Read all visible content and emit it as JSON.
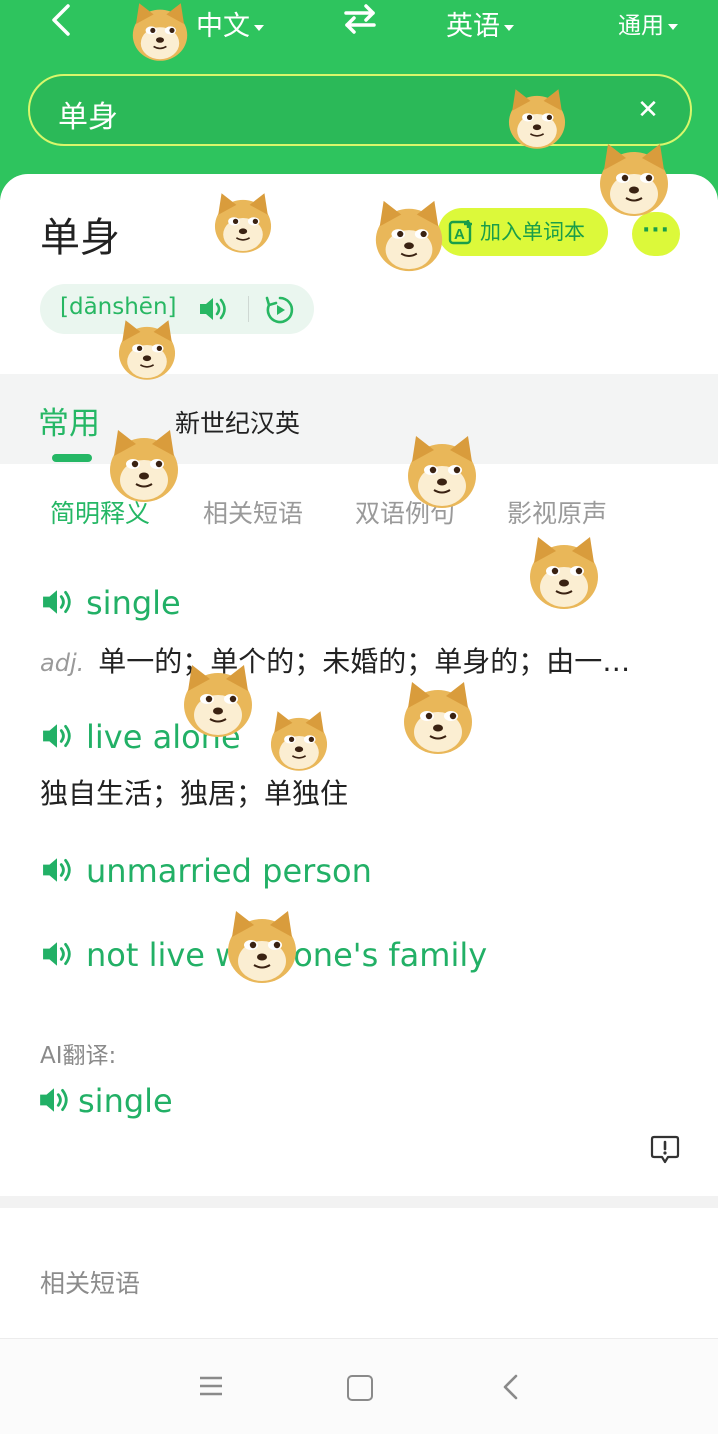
{
  "topbar": {
    "source_lang": "中文",
    "target_lang": "英语",
    "mode": "通用"
  },
  "search": {
    "query": "单身"
  },
  "word": {
    "title": "单身",
    "pinyin": "[dānshēn]",
    "wordbook_label": "加入单词本",
    "more_label": "···"
  },
  "tabs": {
    "main": "常用",
    "other": "新世纪汉英"
  },
  "subtabs": [
    "简明释义",
    "相关短语",
    "双语例句",
    "影视原声"
  ],
  "entries": [
    {
      "term": "single",
      "pos": "adj.",
      "definition": "单一的；单个的；未婚的；单身的；由一…"
    },
    {
      "term": "live alone",
      "pos": "",
      "definition": "独自生活；独居；单独住"
    },
    {
      "term": "unmarried person",
      "pos": "",
      "definition": ""
    },
    {
      "term": "not live with one's family",
      "pos": "",
      "definition": ""
    }
  ],
  "ai": {
    "label": "AI翻译:",
    "result": "single"
  },
  "related": {
    "title": "相关短语"
  },
  "colors": {
    "brand_green": "#2ec45e",
    "accent_lime": "#dcf93a",
    "text_green": "#22b066"
  }
}
